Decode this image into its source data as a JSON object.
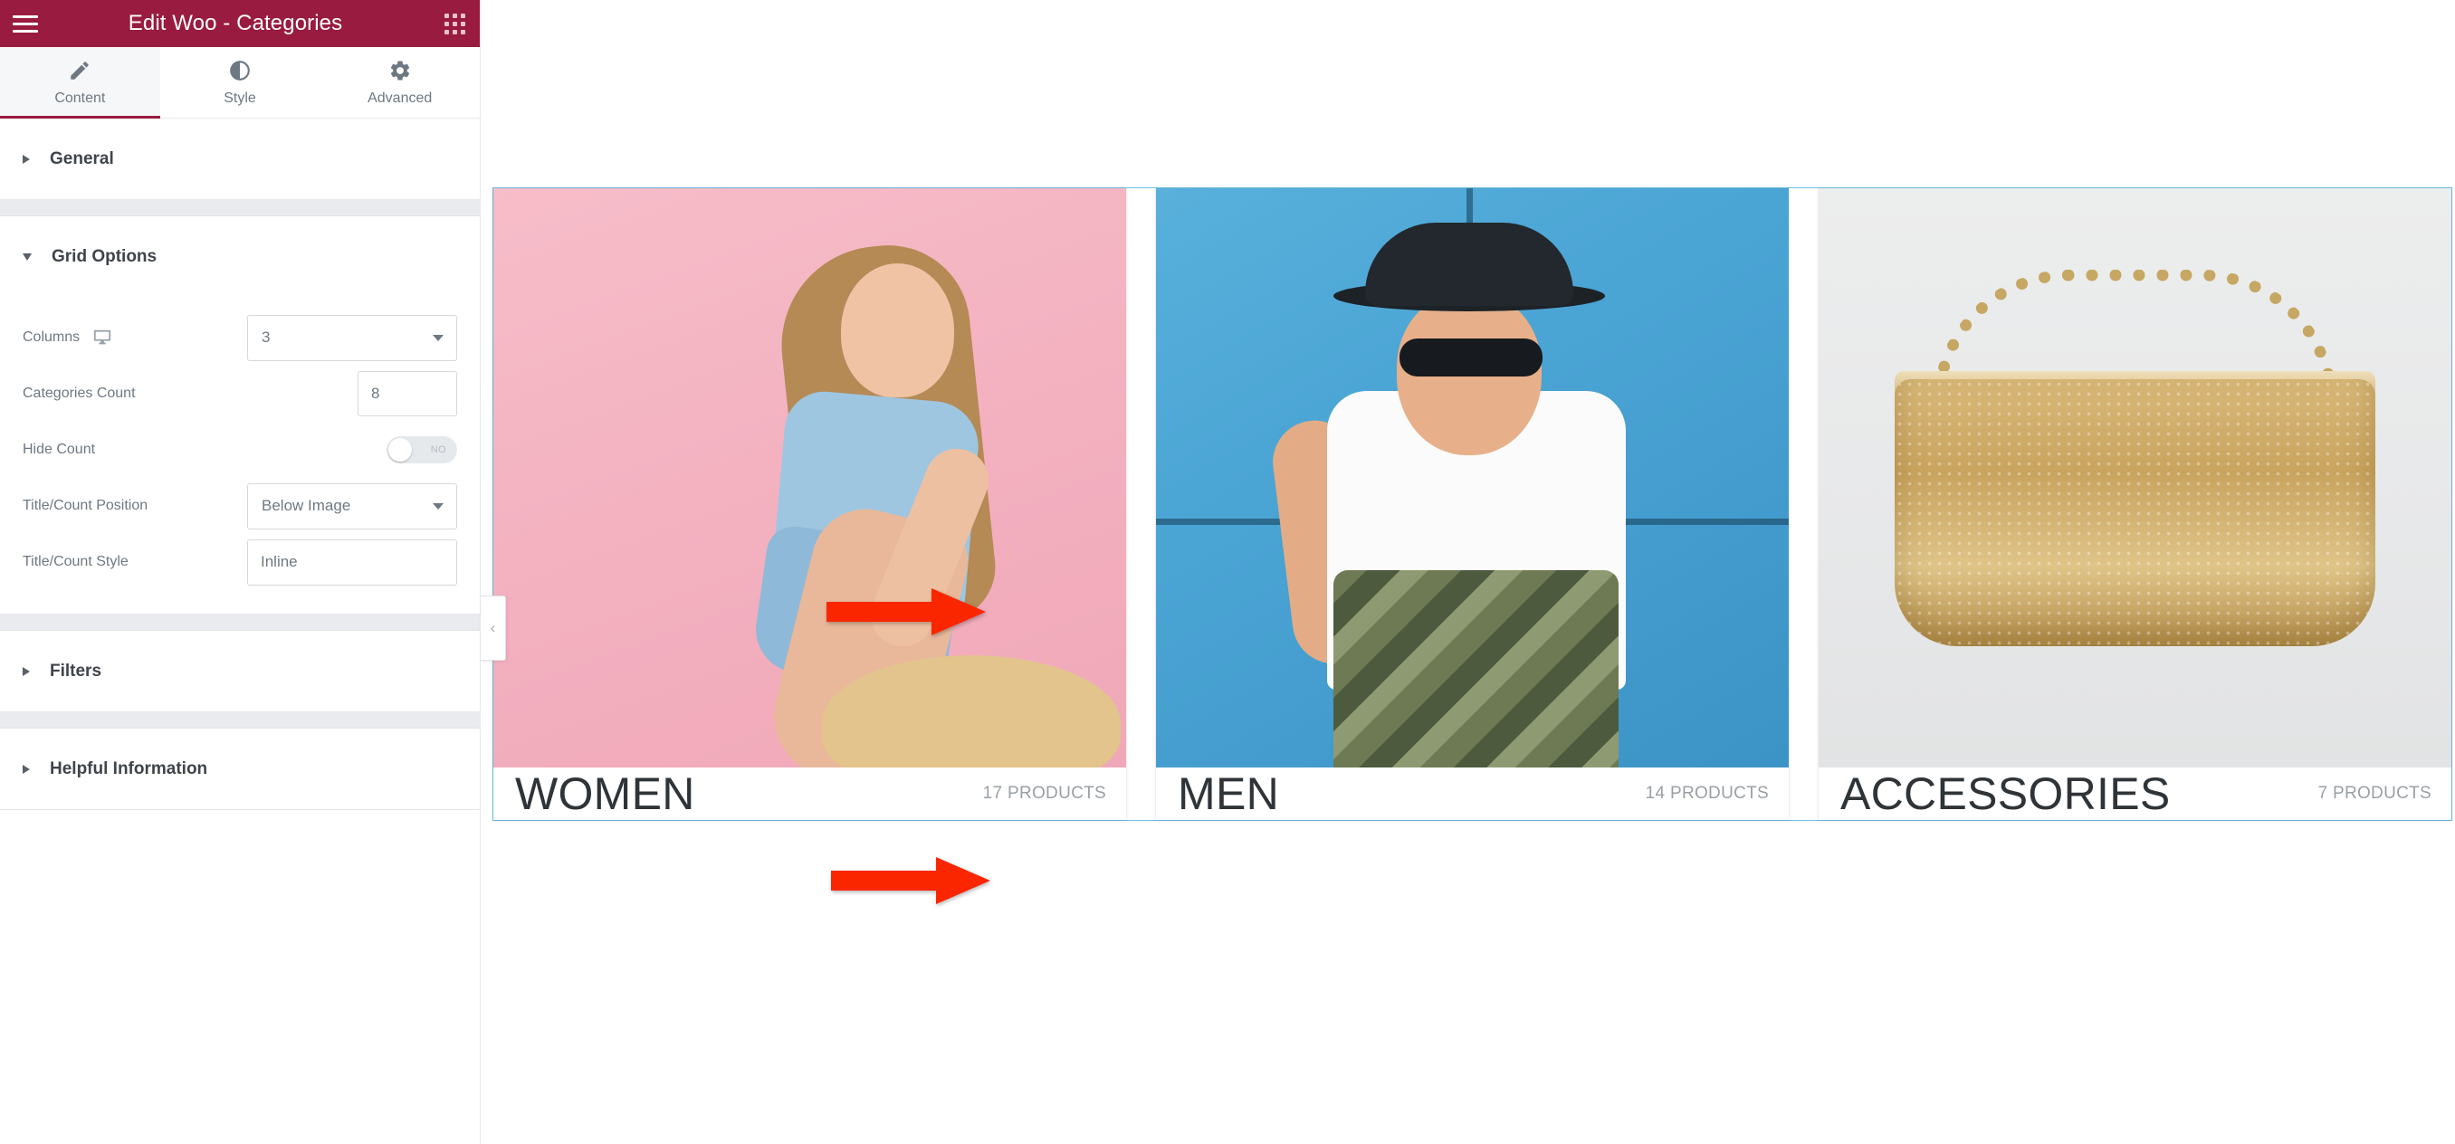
{
  "panel": {
    "title": "Edit Woo - Categories",
    "menu_icon": "hamburger-icon",
    "apps_icon": "apps-grid-icon",
    "collapse_label": "‹",
    "tabs": [
      {
        "label": "Content",
        "icon": "pencil-icon",
        "active": true
      },
      {
        "label": "Style",
        "icon": "contrast-icon",
        "active": false
      },
      {
        "label": "Advanced",
        "icon": "gear-icon",
        "active": false
      }
    ],
    "sections": [
      {
        "name": "General",
        "expanded": false
      },
      {
        "name": "Grid Options",
        "expanded": true
      },
      {
        "name": "Filters",
        "expanded": false
      },
      {
        "name": "Helpful Information",
        "expanded": false
      }
    ],
    "grid_options": {
      "columns": {
        "label": "Columns",
        "device_icon": "desktop-icon",
        "value": "3"
      },
      "categories_count": {
        "label": "Categories Count",
        "value": "8"
      },
      "hide_count": {
        "label": "Hide Count",
        "value": "NO"
      },
      "title_count_position": {
        "label": "Title/Count Position",
        "value": "Below Image"
      },
      "title_count_style": {
        "label": "Title/Count Style",
        "value": "Inline"
      }
    }
  },
  "preview": {
    "categories": [
      {
        "name": "WOMEN",
        "count": "17 PRODUCTS",
        "image": "woman-in-pink-studio"
      },
      {
        "name": "MEN",
        "count": "14 PRODUCTS",
        "image": "man-in-blue-studio"
      },
      {
        "name": "ACCESSORIES",
        "count": "7 PRODUCTS",
        "image": "gold-mesh-handbag"
      }
    ]
  },
  "annotations": {
    "arrow_color": "#fa2600",
    "arrow_style_field": "points-to-title-count-style-field",
    "arrow_women_title": "points-to-women-category-title"
  }
}
